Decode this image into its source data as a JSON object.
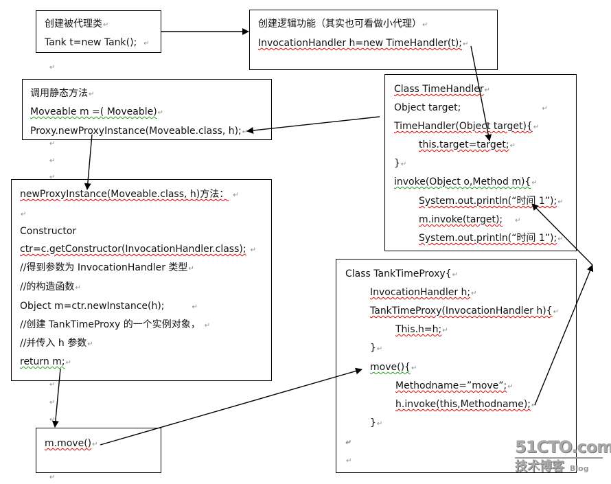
{
  "boxes": {
    "create_proxied": {
      "lines": [
        "创建被代理类",
        "Tank t=new Tank();"
      ]
    },
    "create_logic": {
      "lines": [
        "创建逻辑功能（其实也可看做小代理）",
        "InvocationHandler h=new    TimeHandler(t);"
      ]
    },
    "call_static": {
      "lines": [
        "调用静态方法",
        "Moveable    m =( Moveable)",
        "Proxy.newProxyInstance(Moveable.class, h);"
      ]
    },
    "time_handler": {
      "lines": [
        "Class    TimeHandler",
        "Object target;",
        "TimeHandler(Object  target){",
        "this.target=target;",
        "}",
        "invoke(Object o,Method m){",
        "System.out.println(“时间 1”);",
        "m.invoke(target);",
        "System.out.println(“时间 1”);"
      ]
    },
    "new_proxy_instance": {
      "lines": [
        "newProxyInstance(Moveable.class, h)方法：",
        "",
        "Constructor",
        "ctr=c.getConstructor(InvocationHandler.class);",
        "//得到参数为 InvocationHandler 类型",
        "//的构造函数",
        "Object m=ctr.newInstance(h);",
        "//创建 TankTimeProxy 的一个实例对象，",
        "//并传入 h 参数",
        "return m;"
      ]
    },
    "tank_time_proxy": {
      "lines": [
        "Class TankTimeProxy{",
        "InvocationHandler h;",
        "TankTimeProxy(InvocationHandler h){",
        "This.h=h;",
        "}",
        "move(){",
        "Methodname=”move”;",
        "h.invoke(this,Methodname);",
        "}",
        "",
        ""
      ]
    },
    "call_move": {
      "lines": [
        "m.move()"
      ]
    }
  },
  "paragraph_mark": "↵",
  "watermark": {
    "site": "51CTO.com",
    "subtitle": "技术博客",
    "tag": "Blog"
  }
}
